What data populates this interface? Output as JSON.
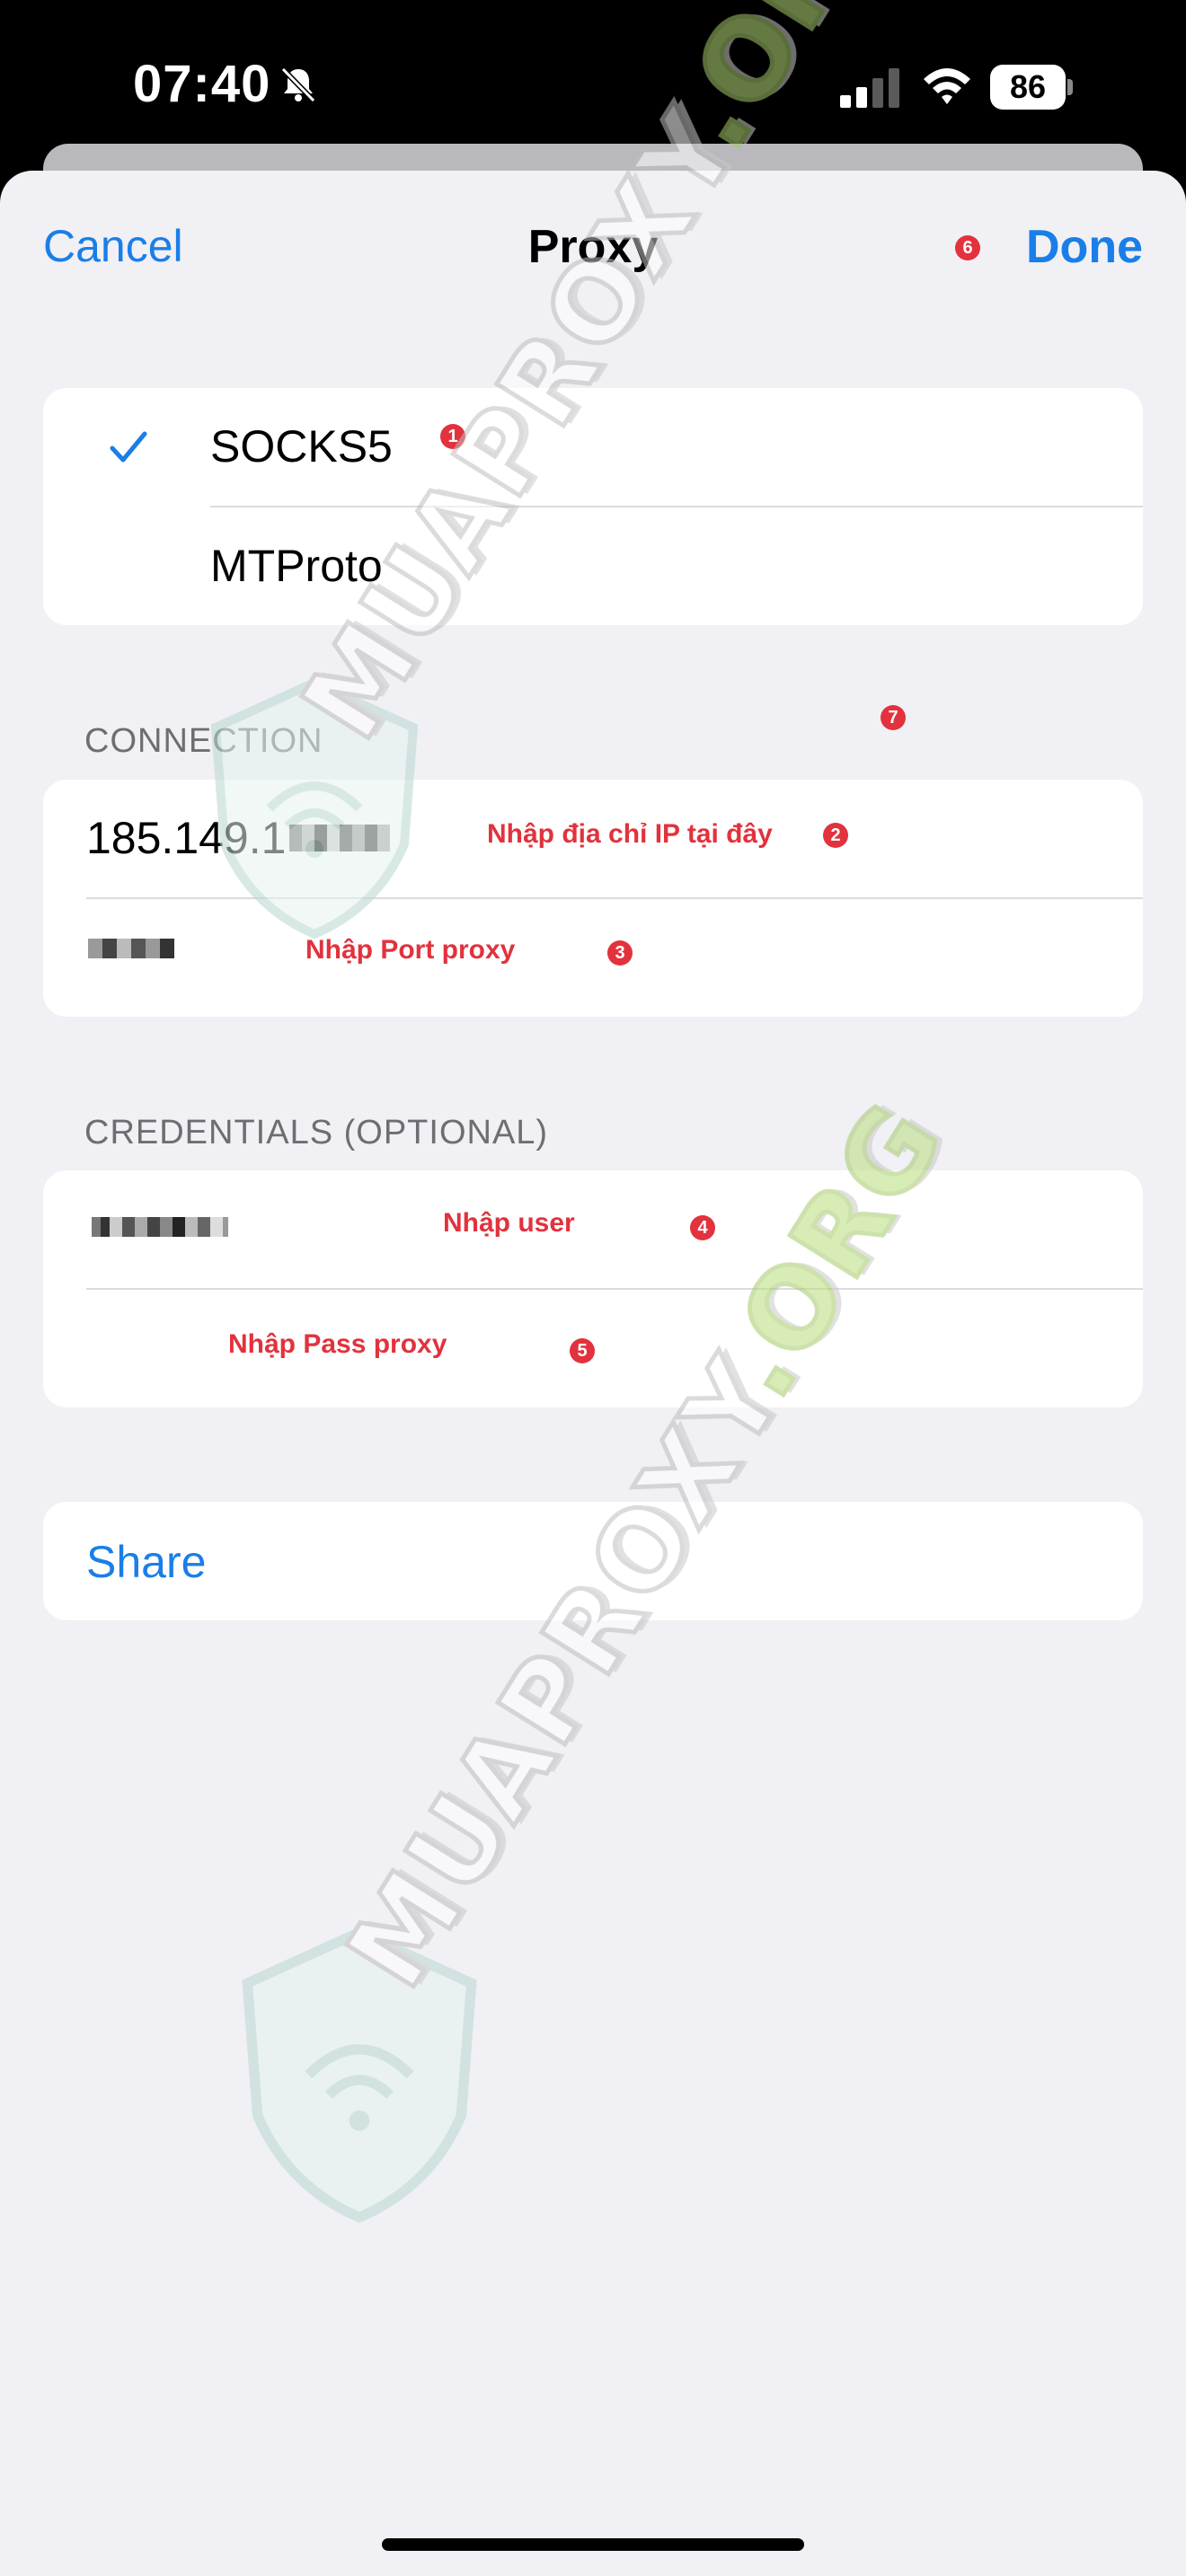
{
  "status_bar": {
    "time": "07:40",
    "battery": "86",
    "icons": [
      "bell-slash-icon",
      "cellular-signal-icon",
      "wifi-icon",
      "battery-icon"
    ]
  },
  "nav": {
    "cancel_label": "Cancel",
    "title": "Proxy",
    "done_label": "Done"
  },
  "proxy_types": [
    {
      "label": "SOCKS5",
      "selected": true
    },
    {
      "label": "MTProto",
      "selected": false
    }
  ],
  "connection": {
    "header": "CONNECTION",
    "server_value": "185.149.1",
    "port_value": ""
  },
  "credentials": {
    "header": "CREDENTIALS (OPTIONAL)",
    "user_value": "",
    "password_value": ""
  },
  "share_label": "Share",
  "annotations": {
    "ip_hint": "Nhập địa chỉ IP tại đây",
    "port_hint": "Nhập Port proxy",
    "user_hint": "Nhập user",
    "pass_hint": "Nhập Pass proxy",
    "badges": [
      "1",
      "2",
      "3",
      "4",
      "5",
      "6",
      "7"
    ]
  },
  "watermark": {
    "text_main": "MUAPROXY",
    "text_suffix": ".ORG"
  },
  "colors": {
    "accent": "#1a7ee8",
    "annotation": "#e2323d",
    "background": "#f0f0f5"
  }
}
